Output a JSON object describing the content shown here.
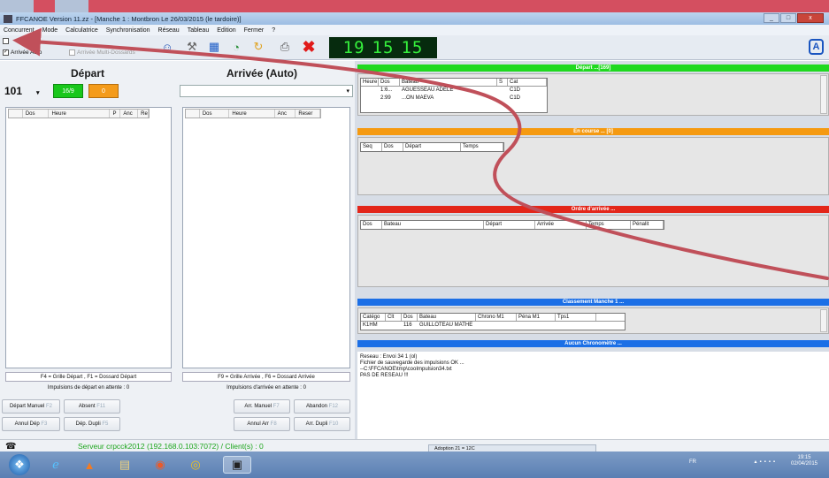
{
  "window": {
    "title": "FFCANOE Version 11.zz - [Manche 1 : Montbron Le 26/03/2015 (le tardoire)]",
    "buttons": [
      "_",
      "□",
      "x"
    ]
  },
  "menu": [
    "Concurrent",
    "Mode",
    "Calculatrice",
    "Synchronisation",
    "Réseau",
    "Tableau",
    "Edition",
    "Fermer",
    "?"
  ],
  "toolbar": {
    "arrivee_auto": "Arrivée Auto",
    "arrivee_multi": "Arrivée Multi-Dossards",
    "clock": [
      "19",
      "15",
      "15"
    ]
  },
  "depart": {
    "title": "Départ",
    "bib_value": "101",
    "green_counter": "16/9",
    "orange_counter": "0",
    "columns": [
      "Dos",
      "Heure",
      "P",
      "Anc",
      "Re"
    ],
    "hint": "F4 = Grille Départ , F1 = Dossard Départ",
    "pending": "Impulsions de départ en attente : 0"
  },
  "arrivee": {
    "title": "Arrivée (Auto)",
    "columns": [
      "Dos",
      "Heure",
      "Anc",
      "Reser"
    ],
    "hint": "F9 = Grille Arrivée , F6 = Dossard Arrivée",
    "pending": "Impulsions d'arrivée en attente : 0"
  },
  "buttons_left": [
    {
      "label": "Départ Manuel",
      "key": "F2"
    },
    {
      "label": "Absent",
      "key": "F11"
    },
    {
      "label": "Annul Dép",
      "key": "F3"
    },
    {
      "label": "Dép. Dupli",
      "key": "F5"
    }
  ],
  "buttons_right": [
    {
      "label": "Arr. Manuel",
      "key": "F7"
    },
    {
      "label": "Abandon",
      "key": "F12"
    },
    {
      "label": "Annul Arr",
      "key": "F8"
    },
    {
      "label": "Arr. Dupli",
      "key": "F10"
    }
  ],
  "sections": {
    "depart_list": {
      "title": "Départ ...[169]",
      "color": "#1fd91f",
      "columns": [
        "Heure",
        "Dos",
        "Bateau",
        "S",
        "Cat"
      ],
      "rows": [
        [
          "",
          "1:6...",
          "AGUESSEAU ADÈLE",
          "",
          "C1D"
        ],
        [
          "",
          "2:99",
          "...ON MAEVA",
          "",
          "C1D"
        ]
      ]
    },
    "en_course": {
      "title": "En course ... [0]",
      "color": "#f59a11",
      "columns": [
        "Seq",
        "Dos",
        "Départ",
        "Temps"
      ]
    },
    "ordre_arrivee": {
      "title": "Ordre d'arrivée ...",
      "color": "#e3261a",
      "columns": [
        "Dos",
        "Bateau",
        "Départ",
        "Arrivée",
        "Temps",
        "Pénalit"
      ]
    },
    "classement": {
      "title": "Classement Manche 1 ...",
      "color": "#1b6fe6",
      "columns": [
        "Catégo",
        "Clt",
        "Dos",
        "Bateau",
        "Chrono M1",
        "Péna M1",
        "Tps1"
      ],
      "rows": [
        [
          "K1HM",
          "",
          "116",
          "GUILLOTEAU MATHE",
          "",
          "",
          ""
        ]
      ]
    },
    "chrono": {
      "title": "Aucun Chronomètre ...",
      "color": "#1b6fe6"
    }
  },
  "log": [
    "Reseau : Envoi 34 1 (ol)",
    "Fichier de sauvegarde des impulsions OK ...",
    "--C:\\FFCANOE\\tmp\\cooImpulsion34.txt",
    "PAS DE RESEAU !!!"
  ],
  "status": {
    "server": "Serveur crpcck2012 (192.168.0.103:7072) / Client(s) : 0",
    "popup": "Adoption 21 = 12C"
  },
  "tray": {
    "lang": "FR",
    "time": "19:15",
    "date": "02/04/2015"
  },
  "colors": {
    "accent_red": "#d44f60",
    "arrow": "#c0505a",
    "clock_digits": "#35f03c"
  }
}
